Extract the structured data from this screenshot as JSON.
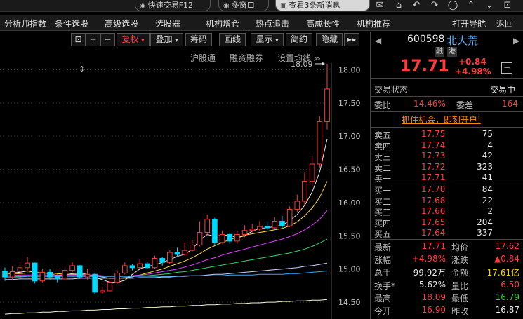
{
  "topbar": {
    "quick_trade": "快速交易F12",
    "multi_window": "多窗口",
    "notice": "查看3条新消息"
  },
  "nav": {
    "items": [
      "分析师指数",
      "条件选股",
      "高级选股",
      "选股器",
      "机构增仓",
      "热点追击",
      "高成长性",
      "机构推荐"
    ],
    "open_nav": "打开导航",
    "back": "返回"
  },
  "chart_toolbar": {
    "plus": "+",
    "minus": "−",
    "fuquan": "复权",
    "overlay": "叠加",
    "chips": "筹码",
    "draw_line": "画线",
    "display": "显示",
    "simple": "简约",
    "hide": "隐藏",
    "more": "▸▸"
  },
  "chart_links": {
    "hk_connect": "沪股通",
    "margin": "融资融券",
    "set_ma": "设置均线"
  },
  "chart_data": {
    "type": "candlestick",
    "y_ticks": [
      "18.00",
      "17.50",
      "17.00",
      "16.50",
      "16.00",
      "15.50",
      "15.00",
      "14.50"
    ],
    "ylim": [
      14.3,
      18.1
    ],
    "max_annotation": "18.09",
    "up_color": "#ff3b3b",
    "down_color": "#00d8ff",
    "candles": [
      [
        14.97,
        14.88,
        15.02,
        14.82
      ],
      [
        14.88,
        14.96,
        15.04,
        14.83
      ],
      [
        14.96,
        15.02,
        15.11,
        14.88
      ],
      [
        15.02,
        15.09,
        15.18,
        14.96
      ],
      [
        15.09,
        14.82,
        15.1,
        14.78
      ],
      [
        14.82,
        14.95,
        15.0,
        14.8
      ],
      [
        14.95,
        14.88,
        15.0,
        14.84
      ],
      [
        14.88,
        14.85,
        14.92,
        14.8
      ],
      [
        14.85,
        14.98,
        15.02,
        14.83
      ],
      [
        14.98,
        15.05,
        15.1,
        14.95
      ],
      [
        15.05,
        14.88,
        15.06,
        14.85
      ],
      [
        14.88,
        14.92,
        15.0,
        14.84
      ],
      [
        14.92,
        14.65,
        14.94,
        14.62
      ],
      [
        14.65,
        14.67,
        14.73,
        14.63
      ],
      [
        14.67,
        14.8,
        14.84,
        14.67
      ],
      [
        14.8,
        14.94,
        14.98,
        14.78
      ],
      [
        14.94,
        15.05,
        15.1,
        14.92
      ],
      [
        15.05,
        15.02,
        15.08,
        14.98
      ],
      [
        15.02,
        15.08,
        15.15,
        15.0
      ],
      [
        15.08,
        15.02,
        15.11,
        15.0
      ],
      [
        15.02,
        15.16,
        15.2,
        15.0
      ],
      [
        15.16,
        15.1,
        15.18,
        15.05
      ],
      [
        15.1,
        15.25,
        15.28,
        15.08
      ],
      [
        15.25,
        15.22,
        15.32,
        15.18
      ],
      [
        15.22,
        15.28,
        15.4,
        15.2
      ],
      [
        15.28,
        15.36,
        15.43,
        15.26
      ],
      [
        15.36,
        15.55,
        15.72,
        15.34
      ],
      [
        15.55,
        15.75,
        15.82,
        15.5
      ],
      [
        15.75,
        15.4,
        15.77,
        15.35
      ],
      [
        15.4,
        15.52,
        15.58,
        15.38
      ],
      [
        15.52,
        15.42,
        15.55,
        15.38
      ],
      [
        15.42,
        15.52,
        15.58,
        15.38
      ],
      [
        15.52,
        15.58,
        15.66,
        15.48
      ],
      [
        15.58,
        15.6,
        15.68,
        15.55
      ],
      [
        15.6,
        15.64,
        15.72,
        15.57
      ],
      [
        15.64,
        15.62,
        15.72,
        15.58
      ],
      [
        15.62,
        15.72,
        15.78,
        15.6
      ],
      [
        15.72,
        15.65,
        15.8,
        15.62
      ],
      [
        15.65,
        15.9,
        15.94,
        15.63
      ],
      [
        15.9,
        16.02,
        16.12,
        15.85
      ],
      [
        16.02,
        16.32,
        16.45,
        15.95
      ],
      [
        16.32,
        16.58,
        16.7,
        16.25
      ],
      [
        16.58,
        17.22,
        17.3,
        16.52
      ],
      [
        17.22,
        17.71,
        18.09,
        17.1
      ]
    ],
    "ma_lines": [
      {
        "color": "#e8e8e8",
        "values": [
          14.94,
          14.94,
          14.95,
          14.97,
          14.95,
          14.94,
          14.93,
          14.9,
          14.91,
          14.93,
          14.94,
          14.92,
          14.87,
          14.84,
          14.8,
          14.8,
          14.83,
          14.92,
          15.0,
          15.04,
          15.06,
          15.1,
          15.14,
          15.19,
          15.22,
          15.3,
          15.43,
          15.52,
          15.49,
          15.51,
          15.51,
          15.47,
          15.5,
          15.57,
          15.61,
          15.62,
          15.64,
          15.66,
          15.73,
          15.82,
          15.96,
          16.16,
          16.46,
          16.96
        ]
      },
      {
        "color": "#ffd84a",
        "values": [
          14.92,
          14.93,
          14.93,
          14.94,
          14.94,
          14.94,
          14.94,
          14.93,
          14.92,
          14.92,
          14.92,
          14.91,
          14.9,
          14.88,
          14.86,
          14.86,
          14.87,
          14.88,
          14.91,
          14.94,
          14.97,
          15.0,
          15.04,
          15.08,
          15.12,
          15.17,
          15.23,
          15.3,
          15.35,
          15.4,
          15.44,
          15.48,
          15.51,
          15.53,
          15.55,
          15.57,
          15.59,
          15.61,
          15.65,
          15.71,
          15.8,
          15.92,
          16.08,
          16.32
        ]
      },
      {
        "color": "#e040ff",
        "values": [
          14.9,
          14.9,
          14.91,
          14.91,
          14.91,
          14.91,
          14.91,
          14.91,
          14.91,
          14.91,
          14.91,
          14.91,
          14.91,
          14.9,
          14.89,
          14.89,
          14.89,
          14.9,
          14.91,
          14.92,
          14.94,
          14.96,
          14.98,
          15.0,
          15.03,
          15.06,
          15.1,
          15.14,
          15.17,
          15.21,
          15.24,
          15.27,
          15.3,
          15.33,
          15.36,
          15.39,
          15.42,
          15.45,
          15.49,
          15.53,
          15.59,
          15.66,
          15.75,
          15.88
        ]
      },
      {
        "color": "#3ad26a",
        "values": [
          14.88,
          14.88,
          14.89,
          14.89,
          14.89,
          14.89,
          14.89,
          14.89,
          14.89,
          14.89,
          14.89,
          14.89,
          14.89,
          14.89,
          14.89,
          14.89,
          14.89,
          14.89,
          14.9,
          14.9,
          14.91,
          14.92,
          14.93,
          14.95,
          14.96,
          14.98,
          15.0,
          15.02,
          15.04,
          15.06,
          15.08,
          15.1,
          15.12,
          15.14,
          15.16,
          15.18,
          15.2,
          15.22,
          15.24,
          15.27,
          15.3,
          15.34,
          15.39,
          15.45
        ]
      },
      {
        "color": "#d0d0ff",
        "values": [
          14.84,
          14.84,
          14.85,
          14.85,
          14.85,
          14.85,
          14.85,
          14.85,
          14.85,
          14.85,
          14.86,
          14.86,
          14.86,
          14.86,
          14.86,
          14.86,
          14.86,
          14.86,
          14.87,
          14.87,
          14.87,
          14.88,
          14.88,
          14.89,
          14.89,
          14.9,
          14.9,
          14.91,
          14.92,
          14.92,
          14.93,
          14.94,
          14.95,
          14.96,
          14.97,
          14.98,
          14.99,
          15.0,
          15.01,
          15.02,
          15.04,
          15.05,
          15.07,
          15.09
        ]
      },
      {
        "color": "#33aaff",
        "values": [
          14.88,
          14.88,
          14.88,
          14.89,
          14.89,
          14.89,
          14.89,
          14.89,
          14.89,
          14.89,
          14.89,
          14.89,
          14.89,
          14.89,
          14.89,
          14.89,
          14.89,
          14.89,
          14.89,
          14.89,
          14.89,
          14.89,
          14.89,
          14.89,
          14.9,
          14.9,
          14.9,
          14.9,
          14.9,
          14.9,
          14.91,
          14.91,
          14.91,
          14.91,
          14.92,
          14.92,
          14.92,
          14.92,
          14.93,
          14.93,
          14.94,
          14.95,
          14.96,
          14.97
        ]
      },
      {
        "color": "#f4f4d0",
        "values": [
          14.32,
          14.33,
          14.33,
          14.34,
          14.34,
          14.35,
          14.35,
          14.36,
          14.36,
          14.37,
          14.37,
          14.38,
          14.38,
          14.39,
          14.39,
          14.4,
          14.4,
          14.41,
          14.41,
          14.42,
          14.42,
          14.43,
          14.43,
          14.44,
          14.44,
          14.45,
          14.45,
          14.46,
          14.46,
          14.47,
          14.47,
          14.48,
          14.48,
          14.49,
          14.49,
          14.5,
          14.5,
          14.51,
          14.51,
          14.52,
          14.52,
          14.53,
          14.53,
          14.54
        ]
      }
    ]
  },
  "quote": {
    "code": "600598",
    "name": "北大荒",
    "badge1": "融",
    "badge2": "港",
    "price": "17.71",
    "change": "+0.84",
    "change_pct": "+4.98%",
    "status_label": "交易状态",
    "status_value": "交易中",
    "wb_label": "委比",
    "wb_value": "14.46%",
    "wc_label": "委差",
    "wc_value": "164",
    "promo": "抓住机会，即刻开户!",
    "asks": [
      {
        "label": "卖五",
        "price": "17.75",
        "vol": "75"
      },
      {
        "label": "卖四",
        "price": "17.74",
        "vol": "4"
      },
      {
        "label": "卖三",
        "price": "17.73",
        "vol": "42"
      },
      {
        "label": "卖二",
        "price": "17.72",
        "vol": "323"
      },
      {
        "label": "卖一",
        "price": "17.71",
        "vol": "41"
      }
    ],
    "bids": [
      {
        "label": "买一",
        "price": "17.70",
        "vol": "84"
      },
      {
        "label": "买二",
        "price": "17.68",
        "vol": "22"
      },
      {
        "label": "买三",
        "price": "17.66",
        "vol": "2"
      },
      {
        "label": "买四",
        "price": "17.65",
        "vol": "204"
      },
      {
        "label": "买五",
        "price": "17.64",
        "vol": "337"
      }
    ],
    "stats": [
      {
        "l1": "最新",
        "v1": "17.71",
        "c1": "red",
        "l2": "均价",
        "v2": "17.62",
        "c2": "red"
      },
      {
        "l1": "涨幅",
        "v1": "+4.98%",
        "c1": "red",
        "l2": "涨跌",
        "v2": "▲0.84",
        "c2": "red"
      },
      {
        "l1": "总手",
        "v1": "99.92万",
        "c1": "white",
        "l2": "金额",
        "v2": "17.61亿",
        "c2": "yellow"
      },
      {
        "l1": "换手*",
        "v1": "5.62%",
        "c1": "white",
        "l2": "量比",
        "v2": "6.50",
        "c2": "red"
      },
      {
        "l1": "最高",
        "v1": "18.09",
        "c1": "red",
        "l2": "最低",
        "v2": "16.79",
        "c2": "green"
      },
      {
        "l1": "今开",
        "v1": "16.90",
        "c1": "red",
        "l2": "昨收",
        "v2": "16.87",
        "c2": "white"
      }
    ]
  }
}
